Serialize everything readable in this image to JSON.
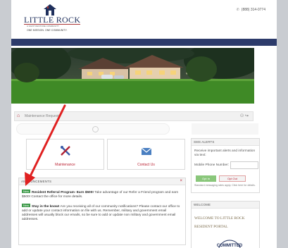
{
  "header": {
    "logo_title": "LITTLE ROCK",
    "logo_sub": "A SAINT RESTORE COMMUNITY",
    "logo_tagline": "ONE MISSION. ONE COMMUNITY.",
    "phone": "(888) 314-0774"
  },
  "breadcrumb": {
    "label": "Maintenance Request",
    "right_icons": "⚇ ↪"
  },
  "tiles": [
    {
      "label": "Maintenance",
      "icon": "tools-icon"
    },
    {
      "label": "Contact Us",
      "icon": "envelope-icon"
    }
  ],
  "announcements": {
    "title": "ANNOUNCEMENTS",
    "close": "×",
    "items": [
      {
        "badge": "New",
        "headline": "Resident Referral Program- Earn $500!",
        "text": " Take advantage of our Refer a Friend program and earn $500! Contact the office for more details."
      },
      {
        "badge": "New",
        "headline": "Stay in the know!",
        "text": " Are you receiving all of our community notifications? Please contact our office to add or update your contact information on file with us. Remember, military and government email addresses will usually block our emails, so be sure to add or update non military and government email addresses."
      }
    ]
  },
  "sms_alerts": {
    "title": "SMS ALERTS",
    "text": "Receive important alerts and information via text:",
    "phone_label": "Mobile Phone Number:",
    "opt_in": "Opt In",
    "opt_out": "Opt Out",
    "note": "Standard messaging rates apply. Click here for details."
  },
  "welcome": {
    "title": "WELCOME",
    "text": "WELCOME TO LITTLE ROCK RESIDENT PORTAL",
    "logo_text": "COMMITTED"
  },
  "colors": {
    "navy": "#2d3b6b",
    "accent_red": "#b22233",
    "new_badge": "#3e9a4a",
    "opt_in_green": "#8ac77b"
  }
}
